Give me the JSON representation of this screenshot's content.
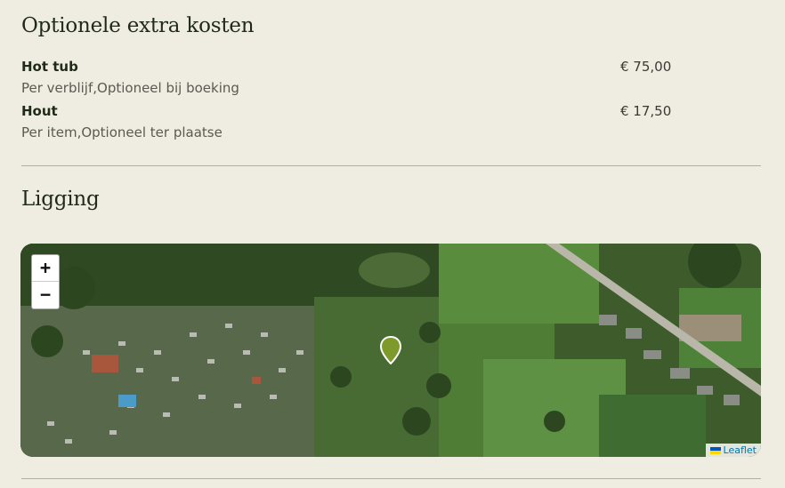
{
  "extra_costs": {
    "title": "Optionele extra kosten",
    "items": [
      {
        "name": "Hot tub",
        "description": "Per verblijf,Optioneel bij boeking",
        "price": "€ 75,00"
      },
      {
        "name": "Hout",
        "description": "Per item,Optioneel ter plaatse",
        "price": "€ 17,50"
      }
    ]
  },
  "location": {
    "title": "Ligging",
    "map": {
      "zoom_in_label": "+",
      "zoom_out_label": "−",
      "attribution": "Leaflet",
      "marker_icon": "map-pin-icon",
      "marker_color": "#7d9a2b"
    }
  },
  "colors": {
    "background": "#efece2",
    "heading": "#1f2a17",
    "muted_text": "#5a5a52",
    "divider": "#b3aea2"
  }
}
